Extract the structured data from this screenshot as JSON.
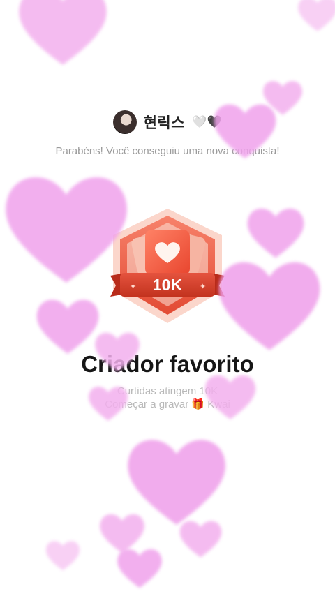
{
  "user": {
    "name": "현릭스",
    "name_hearts": "🤍🖤"
  },
  "congrats_text": "Parabéns! Você conseguiu uma nova conquista!",
  "badge": {
    "value_label": "10K",
    "colors": {
      "primary": "#e8523c",
      "secondary": "#f6a58f",
      "ribbon": "#c93a2a"
    }
  },
  "achievement": {
    "title": "Criador favorito",
    "description_line1": "Curtidas atingem 10K",
    "description_line2": "Começar a gravar 🎁 Kwai"
  },
  "overlay": {
    "heart_color": "#f2a8ee"
  }
}
